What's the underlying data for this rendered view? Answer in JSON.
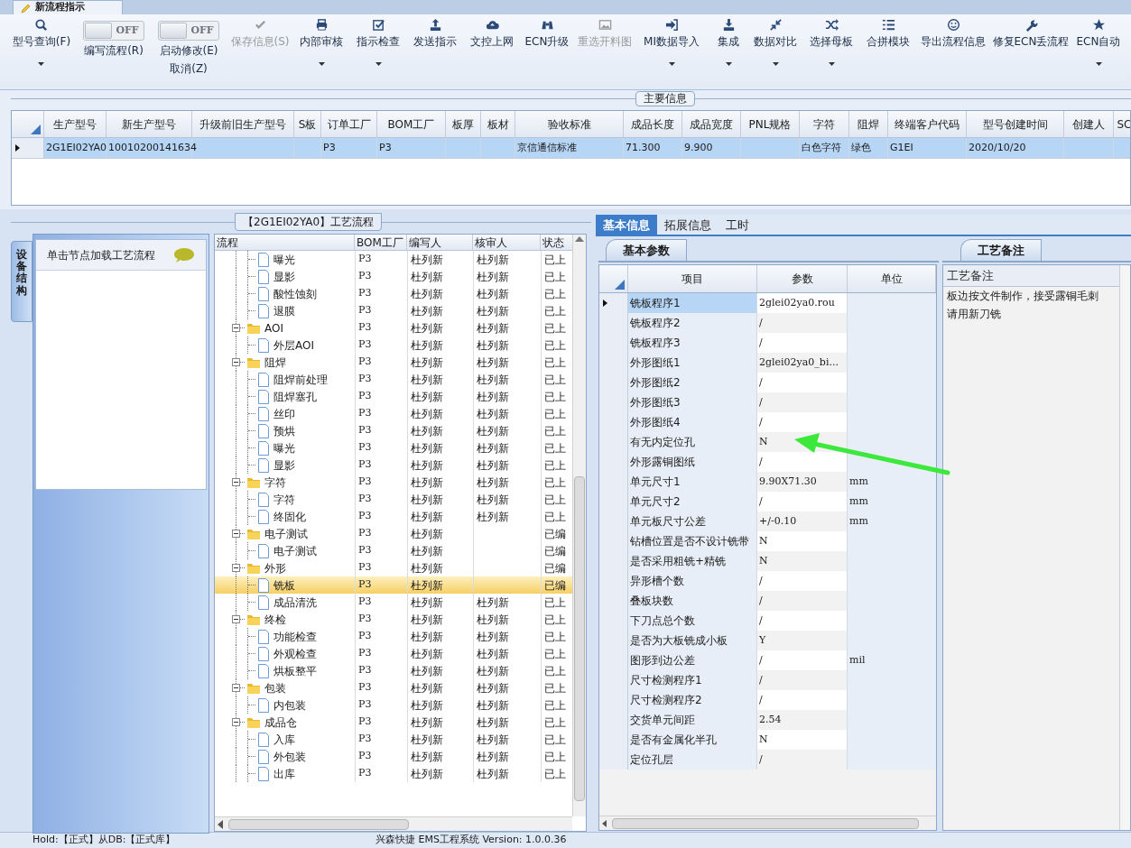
{
  "document_tab": {
    "title": "新流程指示"
  },
  "toolbar": [
    {
      "kind": "button",
      "label": "型号查询(F)",
      "disabled": false,
      "dropdown": true
    },
    {
      "kind": "toggle",
      "toggle_text": "OFF",
      "on": false,
      "label": "编写流程(R)"
    },
    {
      "kind": "toggle",
      "toggle_text": "OFF",
      "on": false,
      "label": "启动修改(E)",
      "label2": "取消(Z)"
    },
    {
      "kind": "button",
      "label": "保存信息(S)",
      "disabled": true,
      "dropdown": false
    },
    {
      "kind": "button",
      "label": "内部审核",
      "disabled": false,
      "dropdown": true
    },
    {
      "kind": "button",
      "label": "指示检查",
      "disabled": false,
      "dropdown": true
    },
    {
      "kind": "button",
      "label": "发送指示",
      "disabled": false,
      "dropdown": false
    },
    {
      "kind": "button",
      "label": "文控上网",
      "disabled": false,
      "dropdown": false
    },
    {
      "kind": "button",
      "label": "ECN升级",
      "disabled": false,
      "dropdown": false
    },
    {
      "kind": "button",
      "label": "重选开料图",
      "disabled": true,
      "dropdown": false
    },
    {
      "kind": "button",
      "label": "MI数据导入",
      "disabled": false,
      "dropdown": true
    },
    {
      "kind": "button",
      "label": "集成",
      "disabled": false,
      "dropdown": true
    },
    {
      "kind": "button",
      "label": "数据对比",
      "disabled": false,
      "dropdown": true
    },
    {
      "kind": "button",
      "label": "选择母板",
      "disabled": false,
      "dropdown": true
    },
    {
      "kind": "button",
      "label": "合拼模块",
      "disabled": false,
      "dropdown": false
    },
    {
      "kind": "button",
      "label": "导出流程信息",
      "disabled": false,
      "dropdown": false
    },
    {
      "kind": "button",
      "label": "修复ECN丢流程",
      "disabled": false,
      "dropdown": false
    },
    {
      "kind": "button",
      "label": "ECN自动",
      "disabled": false,
      "dropdown": true
    }
  ],
  "main_info": {
    "title": "主要信息",
    "columns": [
      "生产型号",
      "新生产型号",
      "升级前旧生产型号",
      "S板",
      "订单工厂",
      "BOM工厂",
      "板厚",
      "板材",
      "验收标准",
      "成品长度",
      "成品宽度",
      "PNL规格",
      "字符",
      "阻焊",
      "终端客户代码",
      "型号创建时间",
      "创建人",
      "SC"
    ],
    "rows": [
      {
        "selected": true,
        "cells": [
          {
            "text": "2G1EI02YA0"
          },
          {
            "text": "10010200141634"
          },
          {},
          {},
          {
            "text": "P3"
          },
          {
            "text": "P3"
          },
          {},
          {},
          {
            "text": "京信通信标准"
          },
          {
            "text": "71.300"
          },
          {
            "text": "9.900"
          },
          {},
          {
            "text": "白色字符"
          },
          {
            "text": "绿色"
          },
          {
            "text": "G1EI"
          },
          {
            "text": "2020/10/20"
          },
          {},
          {}
        ]
      }
    ]
  },
  "process_flow": {
    "title": "【2G1EI02YA0】工艺流程",
    "side_tab": "设备结构",
    "hint": "单击节点加载工艺流程",
    "columns": [
      "流程",
      "BOM工厂",
      "编写人",
      "核审人",
      "状态"
    ],
    "continued_children": [
      {
        "label": "曝光",
        "bom": "P3",
        "writer": "杜列新",
        "reviewer": "杜列新",
        "status": "已上",
        "selected": false
      },
      {
        "label": "显影",
        "bom": "P3",
        "writer": "杜列新",
        "reviewer": "杜列新",
        "status": "已上",
        "selected": false
      },
      {
        "label": "酸性蚀刻",
        "bom": "P3",
        "writer": "杜列新",
        "reviewer": "杜列新",
        "status": "已上",
        "selected": false
      },
      {
        "label": "退膜",
        "bom": "P3",
        "writer": "杜列新",
        "reviewer": "杜列新",
        "status": "已上",
        "selected": false
      }
    ],
    "groups": [
      {
        "label": "AOI",
        "bom": "P3",
        "writer": "杜列新",
        "reviewer": "杜列新",
        "status": "已上",
        "expanded": true,
        "selected": false,
        "children": [
          {
            "label": "外层AOI",
            "bom": "P3",
            "writer": "杜列新",
            "reviewer": "杜列新",
            "status": "已上",
            "selected": false
          }
        ]
      },
      {
        "label": "阻焊",
        "bom": "P3",
        "writer": "杜列新",
        "reviewer": "杜列新",
        "status": "已上",
        "expanded": true,
        "selected": false,
        "children": [
          {
            "label": "阻焊前处理",
            "bom": "P3",
            "writer": "杜列新",
            "reviewer": "杜列新",
            "status": "已上",
            "selected": false
          },
          {
            "label": "阻焊塞孔",
            "bom": "P3",
            "writer": "杜列新",
            "reviewer": "杜列新",
            "status": "已上",
            "selected": false
          },
          {
            "label": "丝印",
            "bom": "P3",
            "writer": "杜列新",
            "reviewer": "杜列新",
            "status": "已上",
            "selected": false
          },
          {
            "label": "预烘",
            "bom": "P3",
            "writer": "杜列新",
            "reviewer": "杜列新",
            "status": "已上",
            "selected": false
          },
          {
            "label": "曝光",
            "bom": "P3",
            "writer": "杜列新",
            "reviewer": "杜列新",
            "status": "已上",
            "selected": false
          },
          {
            "label": "显影",
            "bom": "P3",
            "writer": "杜列新",
            "reviewer": "杜列新",
            "status": "已上",
            "selected": false
          }
        ]
      },
      {
        "label": "字符",
        "bom": "P3",
        "writer": "杜列新",
        "reviewer": "杜列新",
        "status": "已上",
        "expanded": true,
        "selected": false,
        "children": [
          {
            "label": "字符",
            "bom": "P3",
            "writer": "杜列新",
            "reviewer": "杜列新",
            "status": "已上",
            "selected": false
          },
          {
            "label": "终固化",
            "bom": "P3",
            "writer": "杜列新",
            "reviewer": "杜列新",
            "status": "已上",
            "selected": false
          }
        ]
      },
      {
        "label": "电子测试",
        "bom": "P3",
        "writer": "杜列新",
        "status": "已编",
        "expanded": true,
        "selected": false,
        "children": [
          {
            "label": "电子测试",
            "bom": "P3",
            "writer": "杜列新",
            "status": "已编",
            "selected": false
          }
        ]
      },
      {
        "label": "外形",
        "bom": "P3",
        "writer": "杜列新",
        "status": "已编",
        "expanded": true,
        "selected": false,
        "children": [
          {
            "label": "铣板",
            "bom": "P3",
            "writer": "杜列新",
            "status": "已编",
            "selected": true
          },
          {
            "label": "成品清洗",
            "bom": "P3",
            "writer": "杜列新",
            "reviewer": "杜列新",
            "status": "已上",
            "selected": false
          }
        ]
      },
      {
        "label": "终检",
        "bom": "P3",
        "writer": "杜列新",
        "reviewer": "杜列新",
        "status": "已上",
        "expanded": true,
        "selected": false,
        "children": [
          {
            "label": "功能检查",
            "bom": "P3",
            "writer": "杜列新",
            "reviewer": "杜列新",
            "status": "已上",
            "selected": false
          },
          {
            "label": "外观检查",
            "bom": "P3",
            "writer": "杜列新",
            "reviewer": "杜列新",
            "status": "已上",
            "selected": false
          },
          {
            "label": "烘板整平",
            "bom": "P3",
            "writer": "杜列新",
            "reviewer": "杜列新",
            "status": "已上",
            "selected": false
          }
        ]
      },
      {
        "label": "包装",
        "bom": "P3",
        "writer": "杜列新",
        "reviewer": "杜列新",
        "status": "已上",
        "expanded": true,
        "selected": false,
        "children": [
          {
            "label": "内包装",
            "bom": "P3",
            "writer": "杜列新",
            "reviewer": "杜列新",
            "status": "已上",
            "selected": false
          }
        ]
      },
      {
        "label": "成品仓",
        "bom": "P3",
        "writer": "杜列新",
        "reviewer": "杜列新",
        "status": "已上",
        "expanded": true,
        "selected": false,
        "children": [
          {
            "label": "入库",
            "bom": "P3",
            "writer": "杜列新",
            "reviewer": "杜列新",
            "status": "已上",
            "selected": false
          },
          {
            "label": "外包装",
            "bom": "P3",
            "writer": "杜列新",
            "reviewer": "杜列新",
            "status": "已上",
            "selected": false
          },
          {
            "label": "出库",
            "bom": "P3",
            "writer": "杜列新",
            "reviewer": "杜列新",
            "status": "已上",
            "selected": false
          }
        ]
      }
    ]
  },
  "detail_tabs": [
    {
      "label": "基本信息",
      "selected": true
    },
    {
      "label": "拓展信息",
      "selected": false
    },
    {
      "label": "工时",
      "selected": false
    }
  ],
  "basic_params": {
    "title": "基本参数",
    "columns": [
      "项目",
      "参数",
      "单位"
    ],
    "rows": [
      {
        "item": "铣板程序1",
        "value": "2glei02ya0.rou",
        "selected": true
      },
      {
        "item": "铣板程序2",
        "value": "/",
        "selected": false
      },
      {
        "item": "铣板程序3",
        "value": "/",
        "selected": false
      },
      {
        "item": "外形图纸1",
        "value": "2glei02ya0_bi...",
        "selected": false
      },
      {
        "item": "外形图纸2",
        "value": "/",
        "selected": false
      },
      {
        "item": "外形图纸3",
        "value": "/",
        "selected": false
      },
      {
        "item": "外形图纸4",
        "value": "/",
        "selected": false
      },
      {
        "item": "有无内定位孔",
        "value": "N",
        "selected": false
      },
      {
        "item": "外形露铜图纸",
        "value": "/",
        "selected": false
      },
      {
        "item": "单元尺寸1",
        "value": "9.90X71.30",
        "unit": "mm",
        "selected": false
      },
      {
        "item": "单元尺寸2",
        "value": "/",
        "unit": "mm",
        "selected": false
      },
      {
        "item": "单元板尺寸公差",
        "value": "+/-0.10",
        "unit": "mm",
        "selected": false
      },
      {
        "item": "钻槽位置是否不设计铣带",
        "value": "N",
        "selected": false
      },
      {
        "item": "是否采用粗铣+精铣",
        "value": "N",
        "selected": false
      },
      {
        "item": "异形槽个数",
        "value": "/",
        "selected": false
      },
      {
        "item": "叠板块数",
        "value": "/",
        "selected": false
      },
      {
        "item": "下刀点总个数",
        "value": "/",
        "selected": false
      },
      {
        "item": "是否为大板铣成小板",
        "value": "Y",
        "selected": false
      },
      {
        "item": "图形到边公差",
        "value": "/",
        "unit": "mil",
        "selected": false
      },
      {
        "item": "尺寸检测程序1",
        "value": "/",
        "selected": false
      },
      {
        "item": "尺寸检测程序2",
        "value": "/",
        "selected": false
      },
      {
        "item": "交货单元间距",
        "value": "2.54",
        "selected": false
      },
      {
        "item": "是否有金属化半孔",
        "value": "N",
        "selected": false
      },
      {
        "item": "定位孔层",
        "value": "/",
        "selected": false
      }
    ]
  },
  "process_notes": {
    "title": "工艺备注",
    "column": "工艺备注",
    "lines": [
      "板边按文件制作，接受露铜毛刺",
      "请用新刀铣"
    ]
  },
  "status_bar": {
    "left": "Hold:【正式】从DB:【正式库】",
    "right": "兴森快捷 EMS工程系统 Version: 1.0.0.36"
  }
}
